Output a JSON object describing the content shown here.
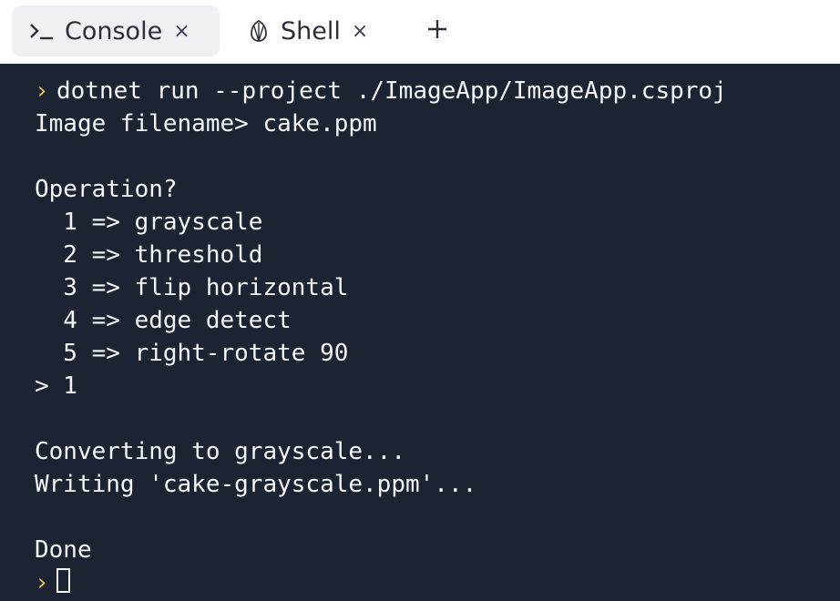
{
  "tabs": [
    {
      "label": "Console",
      "icon": "terminal-icon",
      "close": "×",
      "active": true
    },
    {
      "label": "Shell",
      "icon": "shell-icon",
      "close": "×",
      "active": false
    }
  ],
  "new_tab": {
    "icon": "plus-icon",
    "label": "+"
  },
  "console": {
    "prompt_symbol": "›",
    "command": "dotnet run --project ./ImageApp/ImageApp.csproj",
    "lines": [
      "Image filename> cake.ppm",
      "",
      "Operation?",
      "  1 => grayscale",
      "  2 => threshold",
      "  3 => flip horizontal",
      "  4 => edge detect",
      "  5 => right-rotate 90",
      "> 1",
      "",
      "Converting to grayscale...",
      "Writing 'cake-grayscale.ppm'...",
      "",
      "Done"
    ]
  },
  "colors": {
    "console_background": "#1c2333",
    "console_text": "#f5f7fa",
    "prompt_arrow": "#e6c34a",
    "active_tab_background": "#eef0f4"
  }
}
